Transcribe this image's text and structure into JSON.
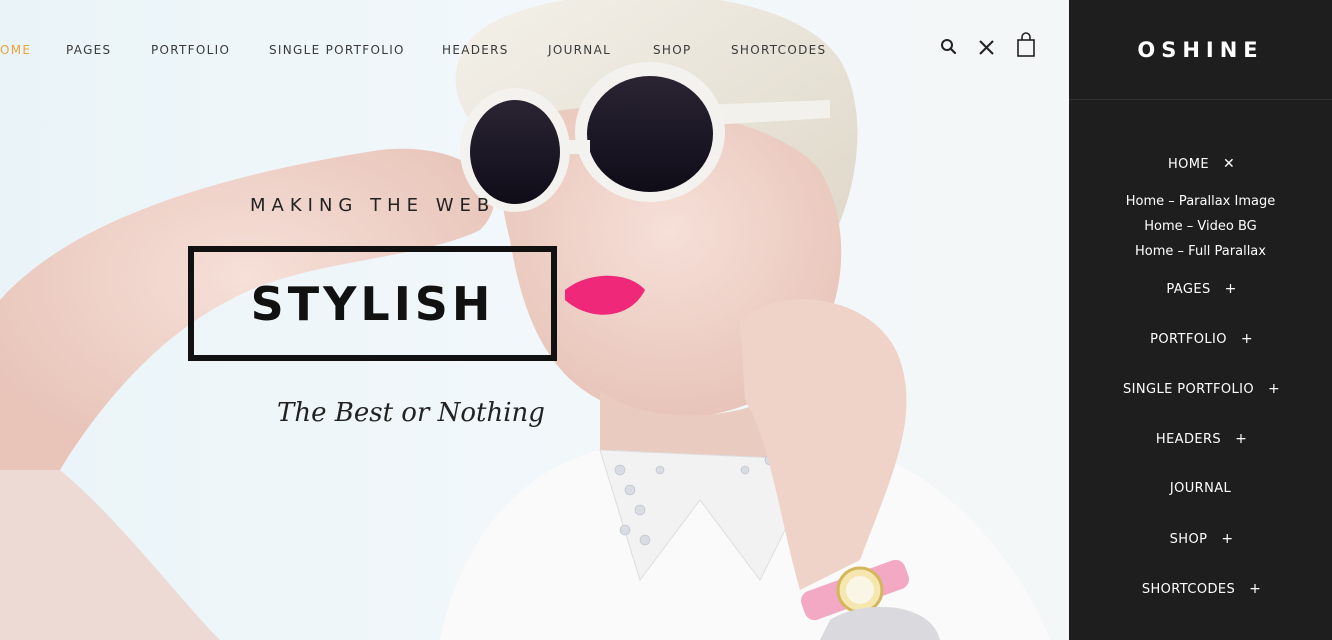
{
  "nav": {
    "items": [
      {
        "label": "OME",
        "active": true
      },
      {
        "label": "PAGES"
      },
      {
        "label": "PORTFOLIO"
      },
      {
        "label": "SINGLE PORTFOLIO"
      },
      {
        "label": "HEADERS"
      },
      {
        "label": "JOURNAL"
      },
      {
        "label": "SHOP"
      },
      {
        "label": "SHORTCODES"
      }
    ],
    "icons": [
      "search-icon",
      "close-icon",
      "shopping-bag-icon"
    ],
    "active_color": "#e8a33c"
  },
  "hero": {
    "tagline": "MAKING THE WEB",
    "headline": "STYLISH",
    "subline": "The Best or Nothing"
  },
  "side": {
    "logo": "OSHINE",
    "menu": [
      {
        "label": "HOME",
        "toggle": "✕"
      },
      {
        "label": "PAGES",
        "toggle": "+"
      },
      {
        "label": "PORTFOLIO",
        "toggle": "+"
      },
      {
        "label": "SINGLE PORTFOLIO",
        "toggle": "+"
      },
      {
        "label": "HEADERS",
        "toggle": "+"
      },
      {
        "label": "JOURNAL",
        "toggle": ""
      },
      {
        "label": "SHOP",
        "toggle": "+"
      },
      {
        "label": "SHORTCODES",
        "toggle": "+"
      }
    ],
    "home_sub": [
      "Home – Parallax Image",
      "Home – Video BG",
      "Home – Full Parallax"
    ],
    "background": "#1e1e1e"
  }
}
